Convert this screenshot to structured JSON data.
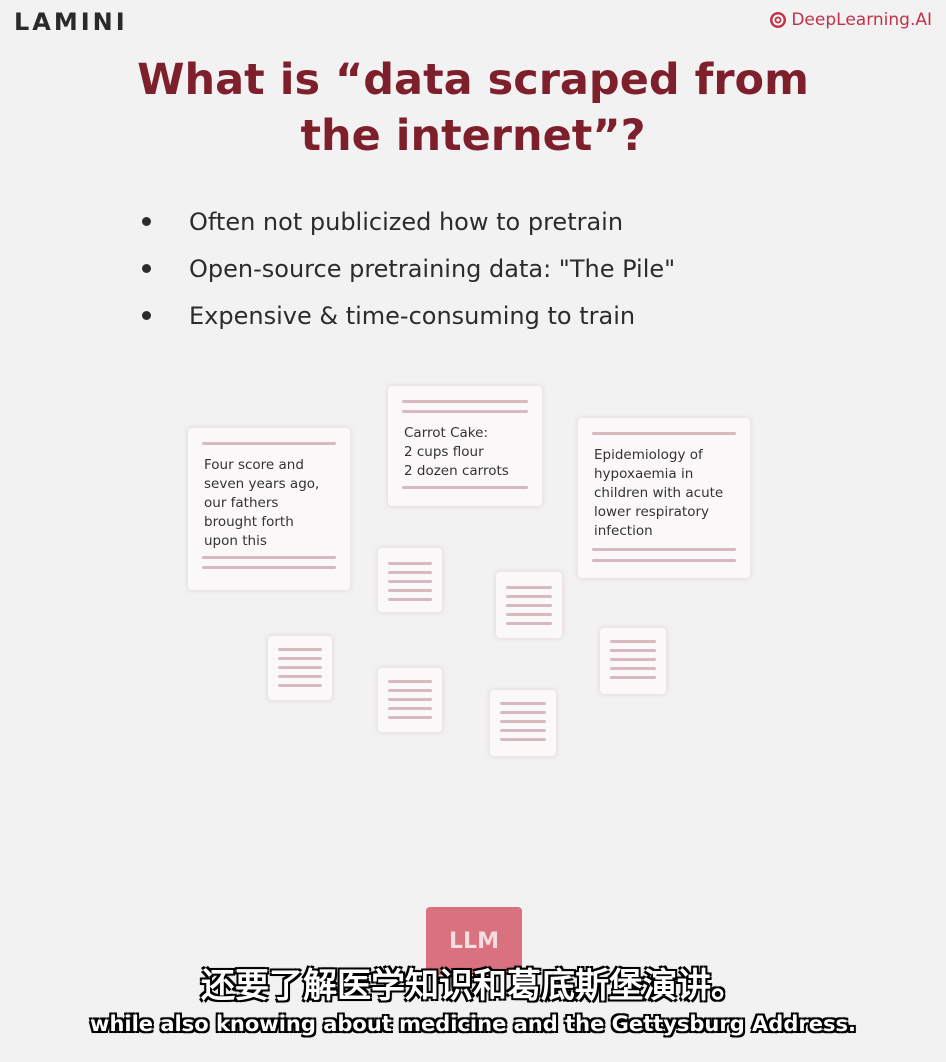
{
  "brand": {
    "lamini": "LAMINI",
    "deeplearning": "DeepLearning.AI",
    "accent": "#7e1f2c",
    "dl_color": "#c0334a"
  },
  "slide": {
    "title": "What is “data scraped from the internet”?",
    "bullets": [
      "Often not publicized how to pretrain",
      "Open-source pretraining data: \"The Pile\"",
      "Expensive & time-consuming to train"
    ]
  },
  "cards": {
    "speech": "Four score and\nseven years ago,\nour fathers\nbrought forth\nupon this",
    "recipe": "Carrot Cake:\n2 cups flour\n2 dozen carrots",
    "medical": "Epidemiology of\nhypoxaemia in\nchildren with acute\nlower respiratory\ninfection"
  },
  "model": {
    "label": "LLM",
    "color": "#d9717f"
  },
  "subtitles": {
    "chinese": "还要了解医学知识和葛底斯堡演讲。",
    "english": "while also knowing about medicine and the Gettysburg Address."
  }
}
